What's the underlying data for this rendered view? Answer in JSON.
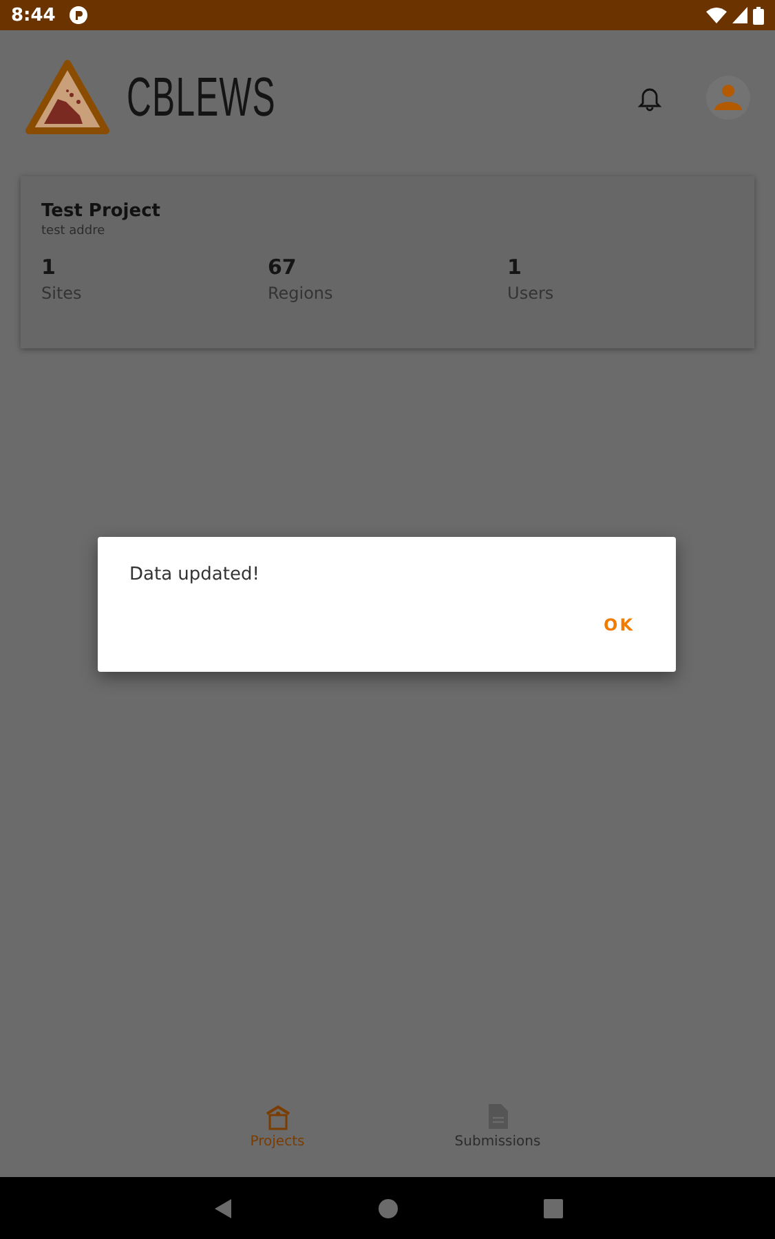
{
  "status_bar": {
    "time": "8:44"
  },
  "header": {
    "app_name": "CBLEWS"
  },
  "project_card": {
    "title": "Test Project",
    "address": "test addre",
    "stats": [
      {
        "value": "1",
        "label": "Sites"
      },
      {
        "value": "67",
        "label": "Regions"
      },
      {
        "value": "1",
        "label": "Users"
      }
    ]
  },
  "dialog": {
    "message": "Data updated!",
    "buttons": [
      "OK"
    ]
  },
  "bottom_nav": [
    {
      "label": "Projects",
      "kind": "projects",
      "selected": true
    },
    {
      "label": "Submissions",
      "kind": "submissions",
      "selected": false
    }
  ]
}
